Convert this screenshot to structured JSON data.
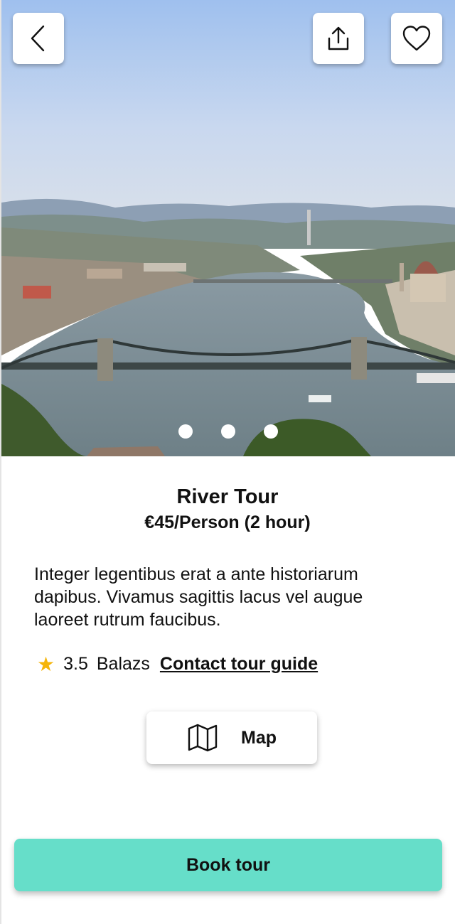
{
  "hero": {
    "image_subject": "river-city-panorama-photo",
    "carousel_dots": 3,
    "back_icon": "chevron-left-icon",
    "share_icon": "share-icon",
    "favorite_icon": "heart-icon"
  },
  "tour": {
    "title": "River Tour",
    "price": "€45/Person (2 hour)",
    "description": "Integer legentibus erat a ante historiarum dapibus. Vivamus sagittis lacus vel augue laoreet rutrum faucibus.",
    "rating": "3.5",
    "guide_name": "Balazs",
    "contact_label": "Contact tour guide"
  },
  "actions": {
    "map_label": "Map",
    "map_icon": "map-icon",
    "book_label": "Book tour"
  },
  "colors": {
    "accent": "#66dec9",
    "star": "#f5b50a"
  }
}
